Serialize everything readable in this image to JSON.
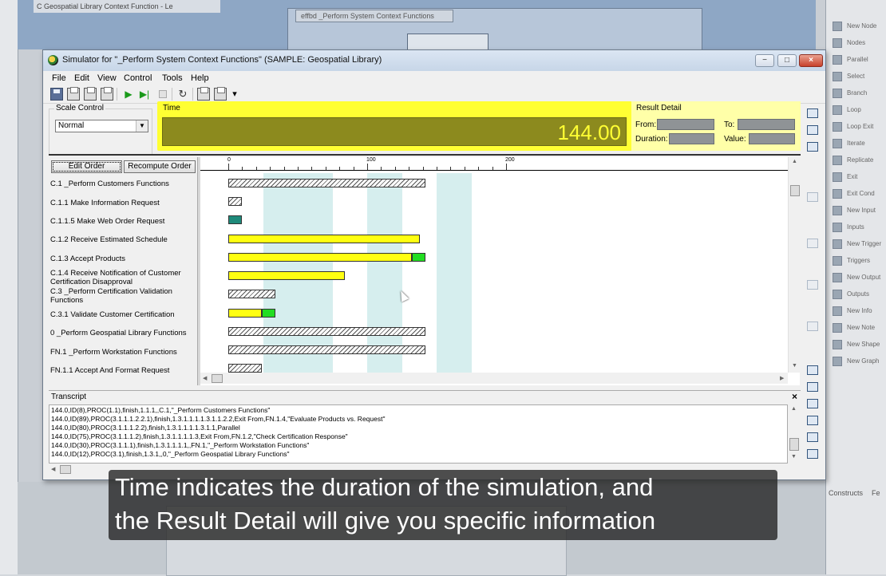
{
  "background": {
    "left_window_title": "C Geospatial Library Context Function - Le",
    "canvas_tab": "effbd _Perform System Context Functions",
    "palette_items": [
      "New Node",
      "Nodes",
      "Parallel",
      "Select",
      "Branch",
      "Loop",
      "Loop Exit",
      "Iterate",
      "Replicate",
      "Exit",
      "Exit Cond",
      "New Input",
      "Inputs",
      "New Trigger",
      "Triggers",
      "New Output",
      "Outputs",
      "New Info",
      "New Note",
      "New Shape",
      "New Graph"
    ],
    "bottom_tabs": [
      "Constructs",
      "Fe"
    ]
  },
  "window": {
    "title": "Simulator for \"_Perform System Context Functions\" (SAMPLE: Geospatial Library)",
    "controls": {
      "minimize": "−",
      "maximize": "□",
      "close": "×"
    }
  },
  "menu": [
    "File",
    "Edit",
    "View",
    "Control",
    "Tools",
    "Help"
  ],
  "toolbar": {
    "icons": [
      "save-icon",
      "print-icon",
      "print-preview-icon",
      "copy-icon",
      "play-icon",
      "step-icon",
      "stop-icon",
      "reset-icon",
      "list-icon",
      "window-icon",
      "dropdown-icon"
    ],
    "play_glyph": "▶",
    "step_glyph": "▶|",
    "reset_glyph": "↻",
    "dropdown_glyph": "▾"
  },
  "scale_control": {
    "label": "Scale Control",
    "value": "Normal",
    "arrow": "▼"
  },
  "time": {
    "label": "Time",
    "value": "144.00",
    "accent": "#ffff33",
    "display_bg": "#8c8a1e"
  },
  "result_detail": {
    "label": "Result Detail",
    "from_label": "From:",
    "to_label": "To:",
    "duration_label": "Duration:",
    "value_label": "Value:"
  },
  "order_buttons": {
    "edit": "Edit Order",
    "recompute": "Recompute Order"
  },
  "tasks": [
    "C.1 _Perform Customers Functions",
    "C.1.1 Make Information Request",
    "C.1.1.5 Make Web Order Request",
    "C.1.2 Receive Estimated Schedule",
    "C.1.3 Accept Products",
    "C.1.4 Receive Notification of Customer Certification Disapproval",
    "C.3 _Perform Certification Validation Functions",
    "C.3.1 Validate Customer Certification",
    "0 _Perform Geospatial Library Functions",
    "FN.1 _Perform Workstation Functions",
    "FN.1.1 Accept And Format Request"
  ],
  "gantt": {
    "ruler_labels": [
      "0",
      "100",
      "200"
    ],
    "scale_max": 200,
    "band_ranges": [
      [
        25,
        50
      ],
      [
        50,
        75
      ],
      [
        100,
        125
      ],
      [
        150,
        175
      ]
    ],
    "bars": [
      [
        {
          "start": 0,
          "end": 142,
          "kind": "hatch"
        }
      ],
      [
        {
          "start": 0,
          "end": 10,
          "kind": "hatch"
        }
      ],
      [
        {
          "start": 0,
          "end": 10,
          "kind": "teal"
        }
      ],
      [
        {
          "start": 0,
          "end": 138,
          "kind": "yellow"
        }
      ],
      [
        {
          "start": 0,
          "end": 132,
          "kind": "yellow"
        },
        {
          "start": 132,
          "end": 142,
          "kind": "green"
        }
      ],
      [
        {
          "start": 0,
          "end": 84,
          "kind": "yellow"
        }
      ],
      [
        {
          "start": 0,
          "end": 34,
          "kind": "hatch"
        }
      ],
      [
        {
          "start": 0,
          "end": 24,
          "kind": "yellow"
        },
        {
          "start": 24,
          "end": 34,
          "kind": "green"
        }
      ],
      [
        {
          "start": 0,
          "end": 142,
          "kind": "hatch"
        }
      ],
      [
        {
          "start": 0,
          "end": 142,
          "kind": "hatch"
        }
      ],
      [
        {
          "start": 0,
          "end": 24,
          "kind": "hatch"
        }
      ]
    ]
  },
  "transcript": {
    "title": "Transcript",
    "close": "×",
    "lines": [
      "144.0,ID(8),PROC(1.1),finish,1.1.1,,C.1,\"_Perform Customers Functions\"",
      "144.0,ID(89),PROC(3.1.1.1.2.2.1),finish,1.3.1.1.1.1.3.1.1.2.2,Exit From,FN.1.4,\"Evaluate Products vs. Request\"",
      "144.0,ID(80),PROC(3.1.1.1.2.2),finish,1.3.1.1.1.1.3.1.1,Parallel",
      "144.0,ID(75),PROC(3.1.1.1.2),finish,1.3.1.1.1.1.3,Exit From,FN.1.2,\"Check Certification Response\"",
      "144.0,ID(30),PROC(3.1.1.1),finish,1.3.1.1.1.1,,FN.1,\"_Perform Workstation Functions\"",
      "144.0,ID(12),PROC(3.1),finish,1.3.1,,0,\"_Perform Geospatial Library Functions\""
    ]
  },
  "caption": {
    "line1": "Time indicates the duration of the simulation, and",
    "line2": "the Result Detail will give you specific information"
  }
}
